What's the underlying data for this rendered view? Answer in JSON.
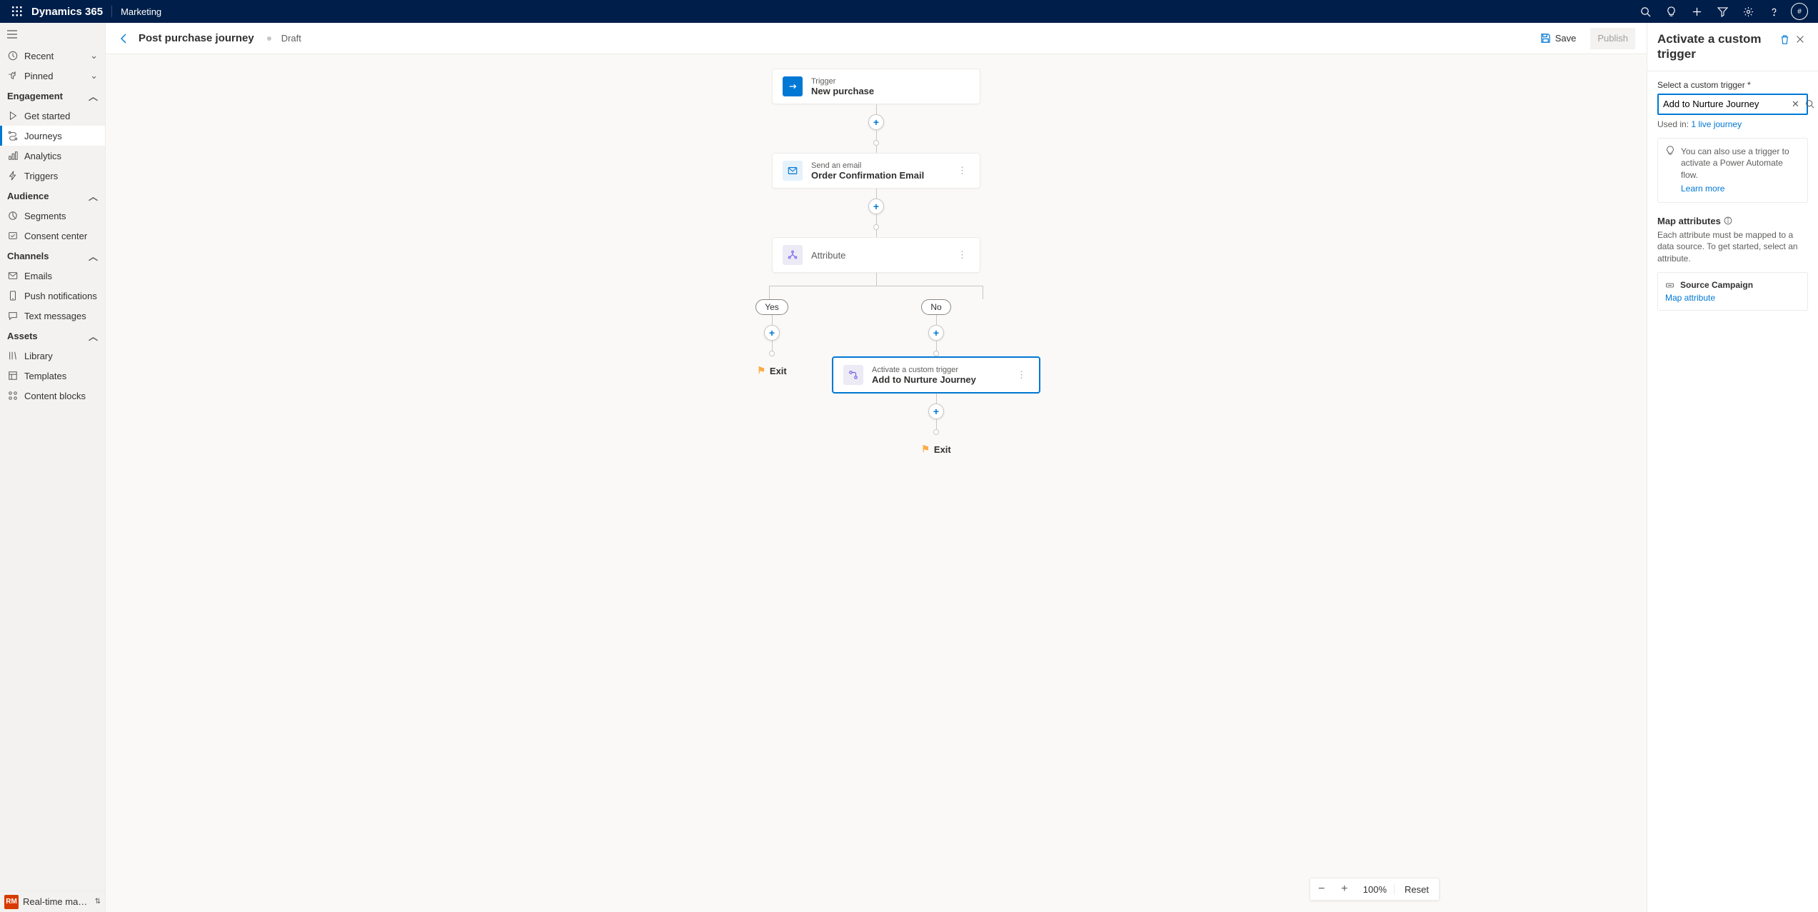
{
  "topbar": {
    "brand": "Dynamics 365",
    "app": "Marketing",
    "avatar": "#"
  },
  "sidebar": {
    "recent": "Recent",
    "pinned": "Pinned",
    "sections": {
      "engagement": {
        "label": "Engagement",
        "items": [
          {
            "label": "Get started"
          },
          {
            "label": "Journeys"
          },
          {
            "label": "Analytics"
          },
          {
            "label": "Triggers"
          }
        ]
      },
      "audience": {
        "label": "Audience",
        "items": [
          {
            "label": "Segments"
          },
          {
            "label": "Consent center"
          }
        ]
      },
      "channels": {
        "label": "Channels",
        "items": [
          {
            "label": "Emails"
          },
          {
            "label": "Push notifications"
          },
          {
            "label": "Text messages"
          }
        ]
      },
      "assets": {
        "label": "Assets",
        "items": [
          {
            "label": "Library"
          },
          {
            "label": "Templates"
          },
          {
            "label": "Content blocks"
          }
        ]
      }
    },
    "persona": {
      "initials": "RM",
      "label": "Real-time marketi..."
    }
  },
  "cmdbar": {
    "title": "Post purchase journey",
    "status": "Draft",
    "save": "Save",
    "publish": "Publish"
  },
  "flow": {
    "n1": {
      "sub": "Trigger",
      "main": "New purchase"
    },
    "n2": {
      "sub": "Send an email",
      "main": "Order Confirmation Email"
    },
    "n3": {
      "main": "Attribute"
    },
    "yes": "Yes",
    "no": "No",
    "n4": {
      "sub": "Activate a custom trigger",
      "main": "Add to Nurture Journey"
    },
    "exit": "Exit"
  },
  "zoom": {
    "value": "100%",
    "reset": "Reset"
  },
  "panel": {
    "title": "Activate a custom trigger",
    "select_label": "Select a custom trigger *",
    "select_value": "Add to Nurture Journey",
    "used_prefix": "Used in: ",
    "used_link": "1 live journey",
    "info": "You can also use a trigger to activate a Power Automate flow.",
    "learn": "Learn more",
    "map_h": "Map attributes",
    "map_p": "Each attribute must be mapped to a data source. To get started, select an attribute.",
    "attr": {
      "name": "Source Campaign",
      "link": "Map attribute"
    }
  }
}
